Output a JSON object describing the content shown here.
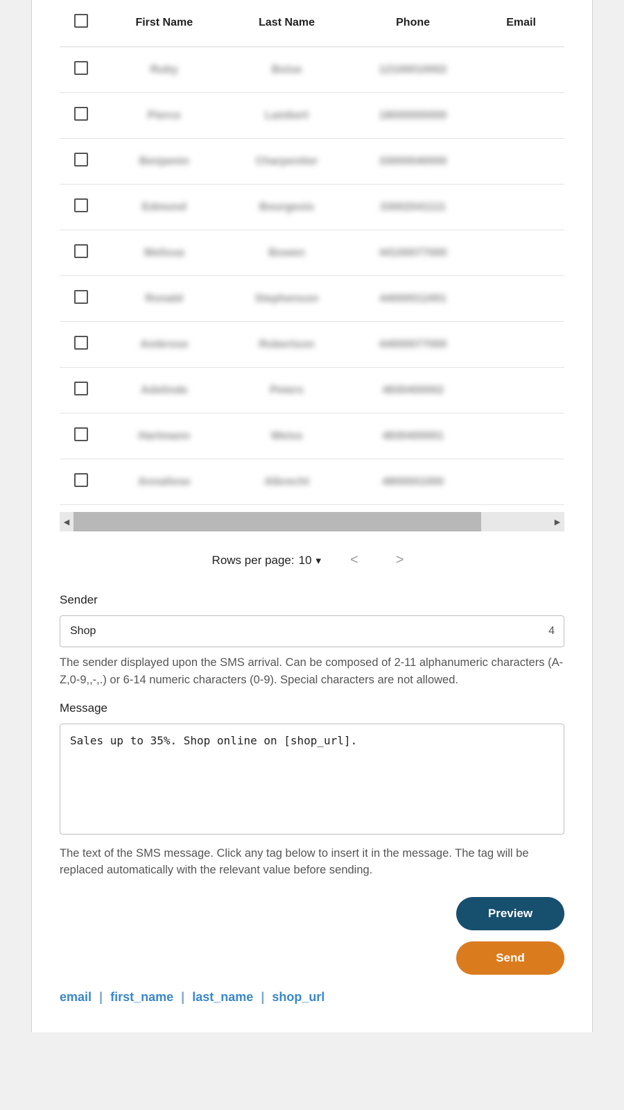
{
  "table": {
    "headers": {
      "first_name": "First Name",
      "last_name": "Last Name",
      "phone": "Phone",
      "email": "Email"
    },
    "rows": [
      {
        "first": "Ruby",
        "last": "Boise",
        "phone": "12100010002",
        "email": ""
      },
      {
        "first": "Pierce",
        "last": "Lambert",
        "phone": "18000000000",
        "email": ""
      },
      {
        "first": "Benjamin",
        "last": "Charpentier",
        "phone": "33000040000",
        "email": ""
      },
      {
        "first": "Edmond",
        "last": "Bourgeois",
        "phone": "33002041111",
        "email": ""
      },
      {
        "first": "Melissa",
        "last": "Bowen",
        "phone": "44100077000",
        "email": ""
      },
      {
        "first": "Ronald",
        "last": "Stephenson",
        "phone": "44000011001",
        "email": ""
      },
      {
        "first": "Ambrose",
        "last": "Robertson",
        "phone": "44000077000",
        "email": ""
      },
      {
        "first": "Adelinde",
        "last": "Peters",
        "phone": "4830400002",
        "email": ""
      },
      {
        "first": "Hartmann",
        "last": "Weiss",
        "phone": "4830400001",
        "email": ""
      },
      {
        "first": "Annaliese",
        "last": "Albrecht",
        "phone": "4800001000",
        "email": ""
      }
    ]
  },
  "pager": {
    "rows_label": "Rows per page:",
    "rows_value": "10"
  },
  "sender": {
    "label": "Sender",
    "value": "Shop",
    "count": "4",
    "hint": "The sender displayed upon the SMS arrival. Can be composed of 2-11 alphanumeric characters (A-Z,0-9,,-,.) or 6-14 numeric characters (0-9). Special characters are not allowed."
  },
  "message": {
    "label": "Message",
    "value": "Sales up to 35%. Shop online on [shop_url].",
    "hint": "The text of the SMS message. Click any tag below to insert it in the message. The tag will be replaced automatically with the relevant value before sending."
  },
  "buttons": {
    "preview": "Preview",
    "send": "Send"
  },
  "tags": {
    "email": "email",
    "first_name": "first_name",
    "last_name": "last_name",
    "shop_url": "shop_url"
  }
}
